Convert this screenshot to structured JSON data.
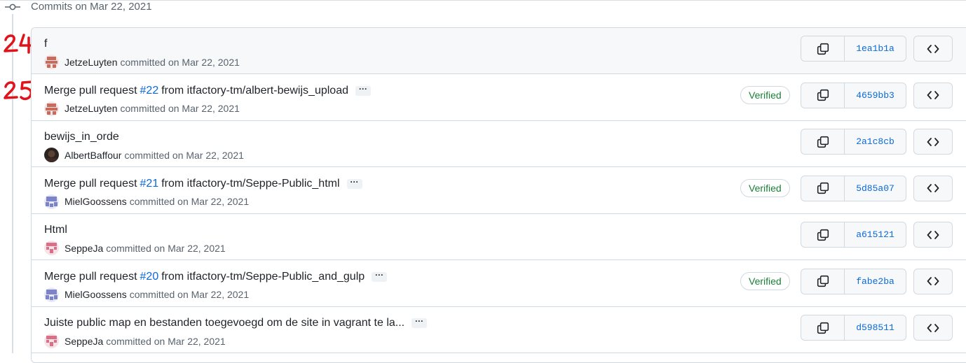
{
  "group": {
    "title": "Commits on Mar 22, 2021"
  },
  "annotations": [
    "24",
    "25"
  ],
  "labels": {
    "committed": "committed on Mar 22, 2021",
    "verified": "Verified",
    "ellipsis": "···"
  },
  "commits": [
    {
      "msg_pre": "f",
      "pr": "",
      "msg_post": "",
      "author": "JetzeLuyten",
      "verified": false,
      "expander": false,
      "sha": "1ea1b1a",
      "avatar": "jetze"
    },
    {
      "msg_pre": "Merge pull request",
      "pr": "#22",
      "msg_post": "from itfactory-tm/albert-bewijs_upload",
      "author": "JetzeLuyten",
      "verified": true,
      "expander": true,
      "sha": "4659bb3",
      "avatar": "jetze"
    },
    {
      "msg_pre": "bewijs_in_orde",
      "pr": "",
      "msg_post": "",
      "author": "AlbertBaffour",
      "verified": false,
      "expander": false,
      "sha": "2a1c8cb",
      "avatar": "albert"
    },
    {
      "msg_pre": "Merge pull request",
      "pr": "#21",
      "msg_post": "from itfactory-tm/Seppe-Public_html",
      "author": "MielGoossens",
      "verified": true,
      "expander": true,
      "sha": "5d85a07",
      "avatar": "miel"
    },
    {
      "msg_pre": "Html",
      "pr": "",
      "msg_post": "",
      "author": "SeppeJa",
      "verified": false,
      "expander": false,
      "sha": "a615121",
      "avatar": "seppe"
    },
    {
      "msg_pre": "Merge pull request",
      "pr": "#20",
      "msg_post": "from itfactory-tm/Seppe-Public_and_gulp",
      "author": "MielGoossens",
      "verified": true,
      "expander": true,
      "sha": "fabe2ba",
      "avatar": "miel"
    },
    {
      "msg_pre": "Juiste public map en bestanden toegevoegd om de site in vagrant te la...",
      "pr": "",
      "msg_post": "",
      "author": "SeppeJa",
      "verified": false,
      "expander": true,
      "sha": "d598511",
      "avatar": "seppe"
    }
  ],
  "colors": {
    "link": "#0969da",
    "verified": "#1a7f37",
    "annotation": "#e0121a",
    "muted": "#59636e"
  },
  "icons": {
    "node": "git-commit-icon",
    "copy": "copy-icon",
    "browse": "code-icon"
  }
}
